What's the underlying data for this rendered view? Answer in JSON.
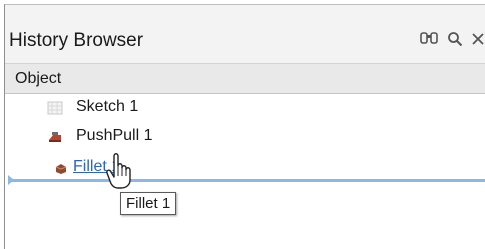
{
  "panel": {
    "title": "History Browser",
    "toolbar": [
      {
        "name": "binoculars-icon",
        "glyph": "👓"
      },
      {
        "name": "search-icon",
        "glyph": "🔍"
      },
      {
        "name": "close-icon",
        "glyph": "✕"
      }
    ]
  },
  "tree": {
    "column_header": "Object",
    "items": [
      {
        "label": "Sketch 1",
        "icon": "sketch-icon"
      },
      {
        "label": "PushPull 1",
        "icon": "pushpull-icon"
      },
      {
        "label": "Fillet 1",
        "icon": "fillet-icon",
        "hovered": true
      }
    ]
  },
  "tooltip": {
    "text": "Fillet 1"
  },
  "colors": {
    "link": "#2a63c9",
    "insert_line": "#8cb8e6"
  }
}
